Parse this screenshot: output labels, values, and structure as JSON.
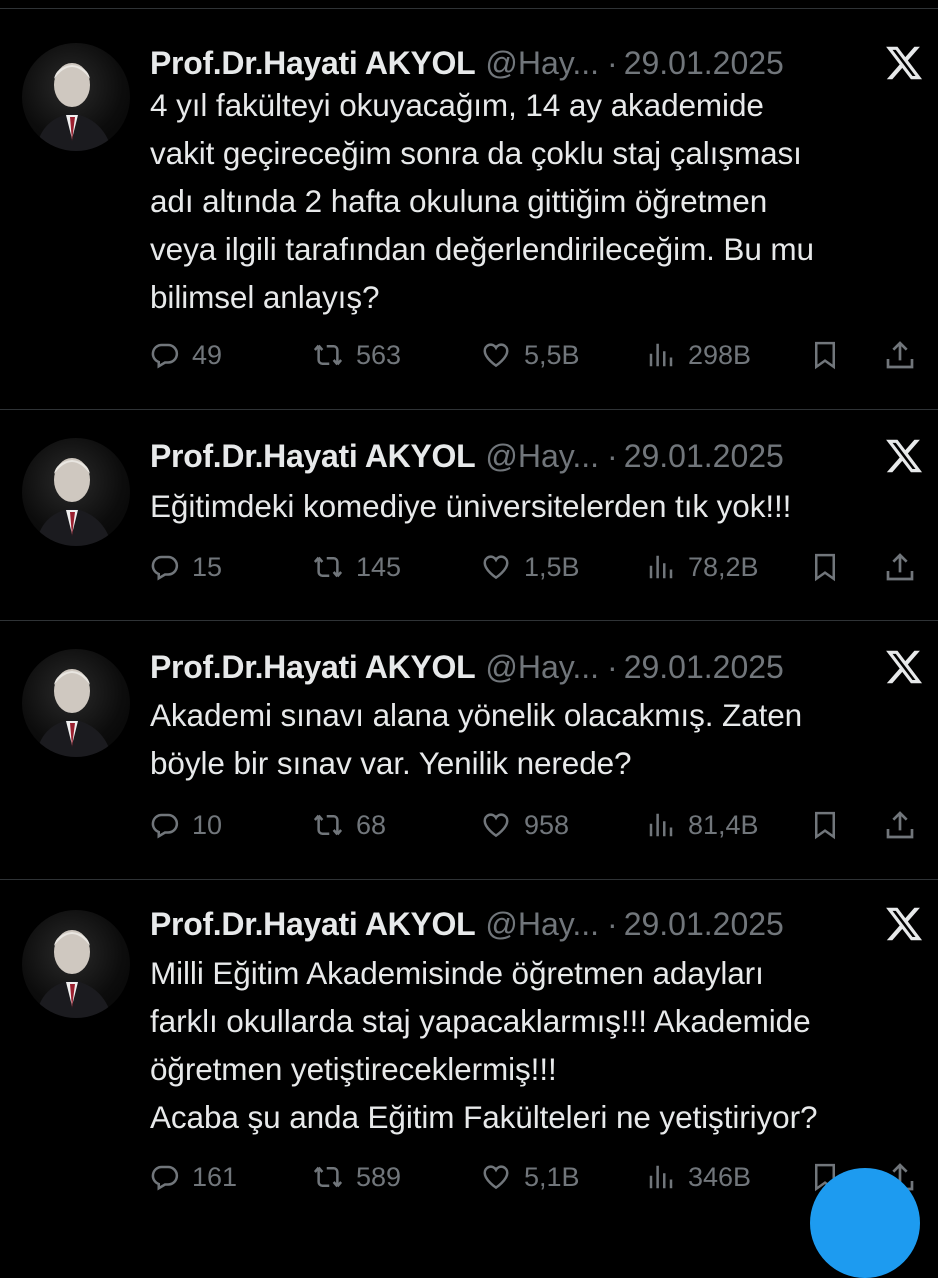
{
  "colors": {
    "background": "#000000",
    "text_primary": "#e7e9ea",
    "text_secondary": "#71767b",
    "divider": "#2f3336",
    "accent": "#1d9bf0"
  },
  "icons": {
    "reply": "reply-icon",
    "retweet": "retweet-icon",
    "like": "heart-icon",
    "views": "views-icon",
    "bookmark": "bookmark-icon",
    "share": "share-icon",
    "logo": "x-logo-icon"
  },
  "tweets": [
    {
      "name": "Prof.Dr.Hayati AKYOL",
      "handle": "@Hay...",
      "separator": "·",
      "date": "29.01.2025",
      "text": "4 yıl fakülteyi okuyacağım, 14 ay akademide\nvakit geçireceğim sonra da çoklu staj çalışması\nadı altında 2 hafta okuluna gittiğim öğretmen\nveya ilgili tarafından değerlendirileceğim. Bu mu\nbilimsel anlayış?",
      "replies": "49",
      "retweets": "563",
      "likes": "5,5B",
      "views": "298B"
    },
    {
      "name": "Prof.Dr.Hayati AKYOL",
      "handle": "@Hay...",
      "separator": "·",
      "date": "29.01.2025",
      "text": "Eğitimdeki komediye üniversitelerden tık yok!!!",
      "replies": "15",
      "retweets": "145",
      "likes": "1,5B",
      "views": "78,2B"
    },
    {
      "name": "Prof.Dr.Hayati AKYOL",
      "handle": "@Hay...",
      "separator": "·",
      "date": "29.01.2025",
      "text": "Akademi sınavı alana yönelik olacakmış. Zaten\nböyle bir sınav var. Yenilik nerede?",
      "replies": "10",
      "retweets": "68",
      "likes": "958",
      "views": "81,4B"
    },
    {
      "name": "Prof.Dr.Hayati AKYOL",
      "handle": "@Hay...",
      "separator": "·",
      "date": "29.01.2025",
      "text": "Milli Eğitim Akademisinde öğretmen adayları\nfarklı okullarda staj yapacaklarmış!!! Akademide\nöğretmen yetiştireceklermiş!!!\nAcaba şu anda Eğitim Fakülteleri ne yetiştiriyor?",
      "replies": "161",
      "retweets": "589",
      "likes": "5,1B",
      "views": "346B"
    }
  ]
}
